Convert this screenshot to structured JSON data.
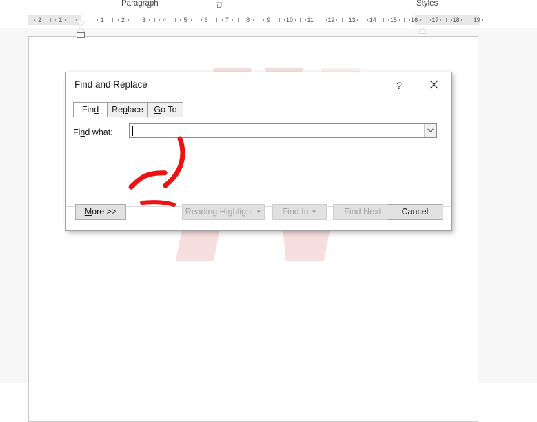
{
  "ribbon": {
    "groups": [
      {
        "name": "paragraph",
        "label": "Paragraph"
      },
      {
        "name": "styles",
        "label": "Styles"
      }
    ],
    "launcher_icon": "dialog-box-launcher-icon"
  },
  "ruler": {
    "unit": "inches",
    "left_numbers": [
      "2",
      "1"
    ],
    "numbers": [
      "1",
      "2",
      "3",
      "4",
      "5",
      "6",
      "7",
      "8",
      "9",
      "10",
      "11",
      "12",
      "13",
      "14",
      "15",
      "16",
      "17",
      "18",
      "19"
    ],
    "first_line_indent_marker": "first-line-indent-marker",
    "hanging_indent_marker": "hanging-indent-marker",
    "left_indent_marker": "left-indent-marker",
    "right_indent_marker": "right-indent-marker"
  },
  "dialog": {
    "title": "Find and Replace",
    "help_label": "?",
    "close_label": "✕",
    "tabs": [
      {
        "label": "Find",
        "mnemonic_index": 3,
        "active": true
      },
      {
        "label": "Replace",
        "mnemonic_index": 2,
        "active": false
      },
      {
        "label": "Go To",
        "mnemonic_index": 0,
        "active": false
      }
    ],
    "find_what": {
      "label": "Find what:",
      "label_mnemonic_index": 2,
      "value": "",
      "placeholder": "",
      "dropdown_icon": "chevron-down-icon"
    },
    "buttons": [
      {
        "name": "more",
        "label": "More >>",
        "enabled": true,
        "has_dropdown": false
      },
      {
        "name": "reading",
        "label": "Reading Highlight",
        "enabled": false,
        "has_dropdown": true
      },
      {
        "name": "findin",
        "label": "Find In",
        "enabled": false,
        "has_dropdown": true
      },
      {
        "name": "next",
        "label": "Find Next",
        "enabled": false,
        "has_dropdown": false
      },
      {
        "name": "cancel",
        "label": "Cancel",
        "enabled": true,
        "has_dropdown": false
      }
    ]
  },
  "annotation": {
    "type": "red-curved-arrow",
    "points_to": "more-button",
    "color": "#ee1111"
  },
  "watermark": {
    "text": "UI",
    "color": "#f6dede"
  },
  "colors": {
    "page_background": "#f7f7f7",
    "dialog_background": "#ffffff",
    "button_face": "#e1e1e1",
    "disabled_text": "#a6a6a6",
    "accent_red": "#ee1111"
  }
}
